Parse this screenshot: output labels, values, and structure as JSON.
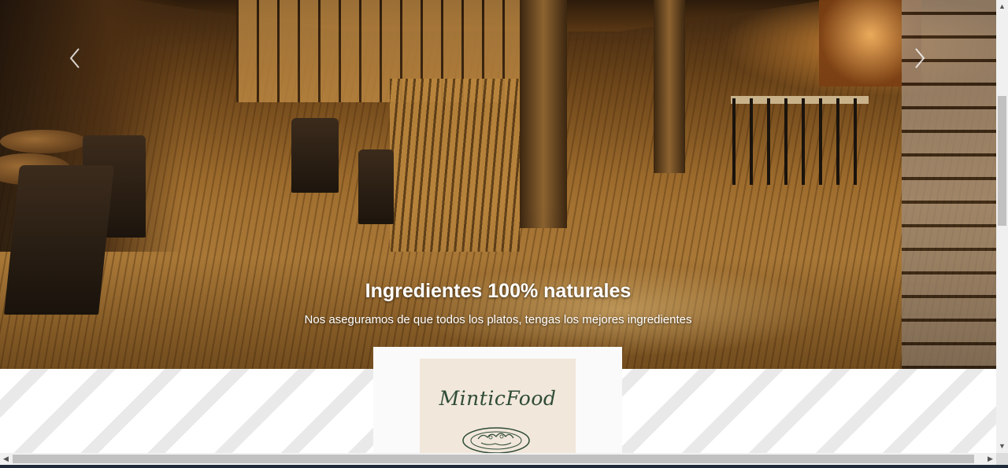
{
  "carousel": {
    "caption_title": "Ingredientes 100% naturales",
    "caption_subtitle": "Nos aseguramos de que todos los platos, tengas los mejores ingredientes",
    "prev_icon": "chevron-left-icon",
    "next_icon": "chevron-right-icon"
  },
  "brand": {
    "logo_text": "MinticFood"
  },
  "colors": {
    "logo_background": "#f1e7da",
    "logo_ink": "#2e4b36",
    "caption_text": "#ffffff"
  }
}
